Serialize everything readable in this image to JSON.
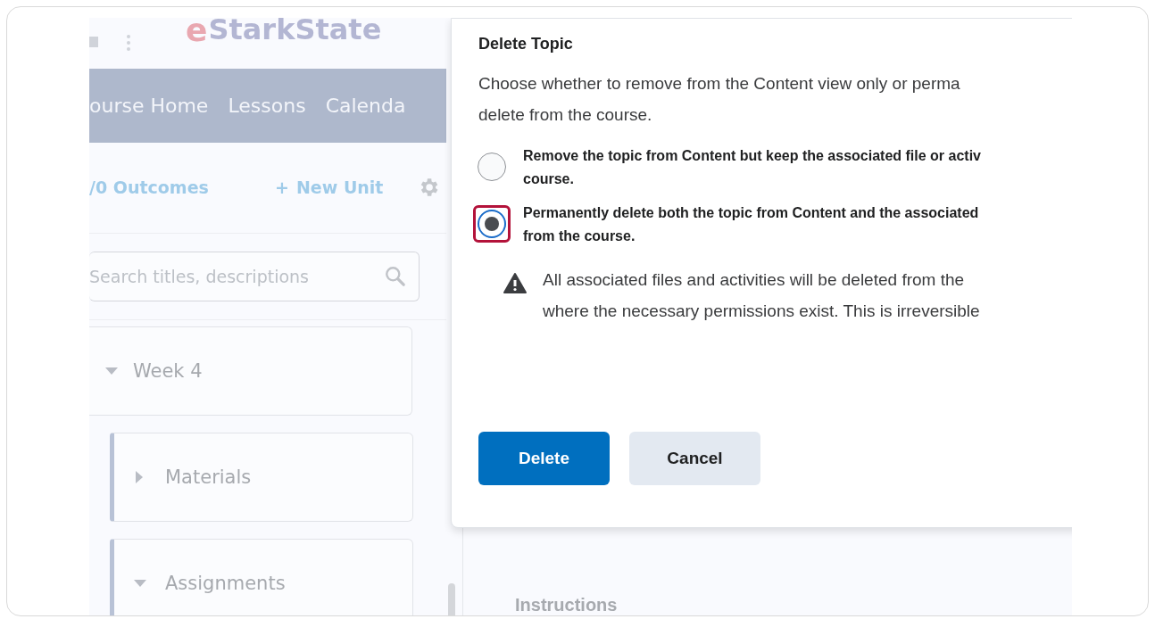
{
  "header": {
    "logo": {
      "mark": "e",
      "name": "StarkState"
    }
  },
  "nav": [
    "ourse Home",
    "Lessons",
    "Calenda"
  ],
  "toolbar": {
    "outcomes": "/0 Outcomes",
    "new_unit": {
      "icon": "+",
      "label": "New Unit"
    }
  },
  "search": {
    "placeholder": "Search titles, descriptions"
  },
  "tree": [
    {
      "label": "Week 4",
      "expanded": true,
      "children": [
        {
          "label": "Materials",
          "expanded": false
        },
        {
          "label": "Assignments",
          "expanded": true
        }
      ]
    }
  ],
  "content": {
    "heading": "Instructions"
  },
  "dialog": {
    "title": "Delete Topic",
    "description": [
      "Choose whether to remove from the Content view only or perma",
      "delete from the course."
    ],
    "options": [
      {
        "lines": [
          "Remove the topic from Content but keep the associated file or activ",
          "course."
        ],
        "selected": false
      },
      {
        "lines": [
          "Permanently delete both the topic from Content and the associated",
          "from the course."
        ],
        "selected": true
      }
    ],
    "warning": [
      "All associated files and activities will be deleted from the",
      "where the necessary permissions exist. This is irreversible"
    ],
    "buttons": [
      {
        "label": "Delete",
        "kind": "primary"
      },
      {
        "label": "Cancel",
        "kind": "secondary"
      }
    ]
  }
}
